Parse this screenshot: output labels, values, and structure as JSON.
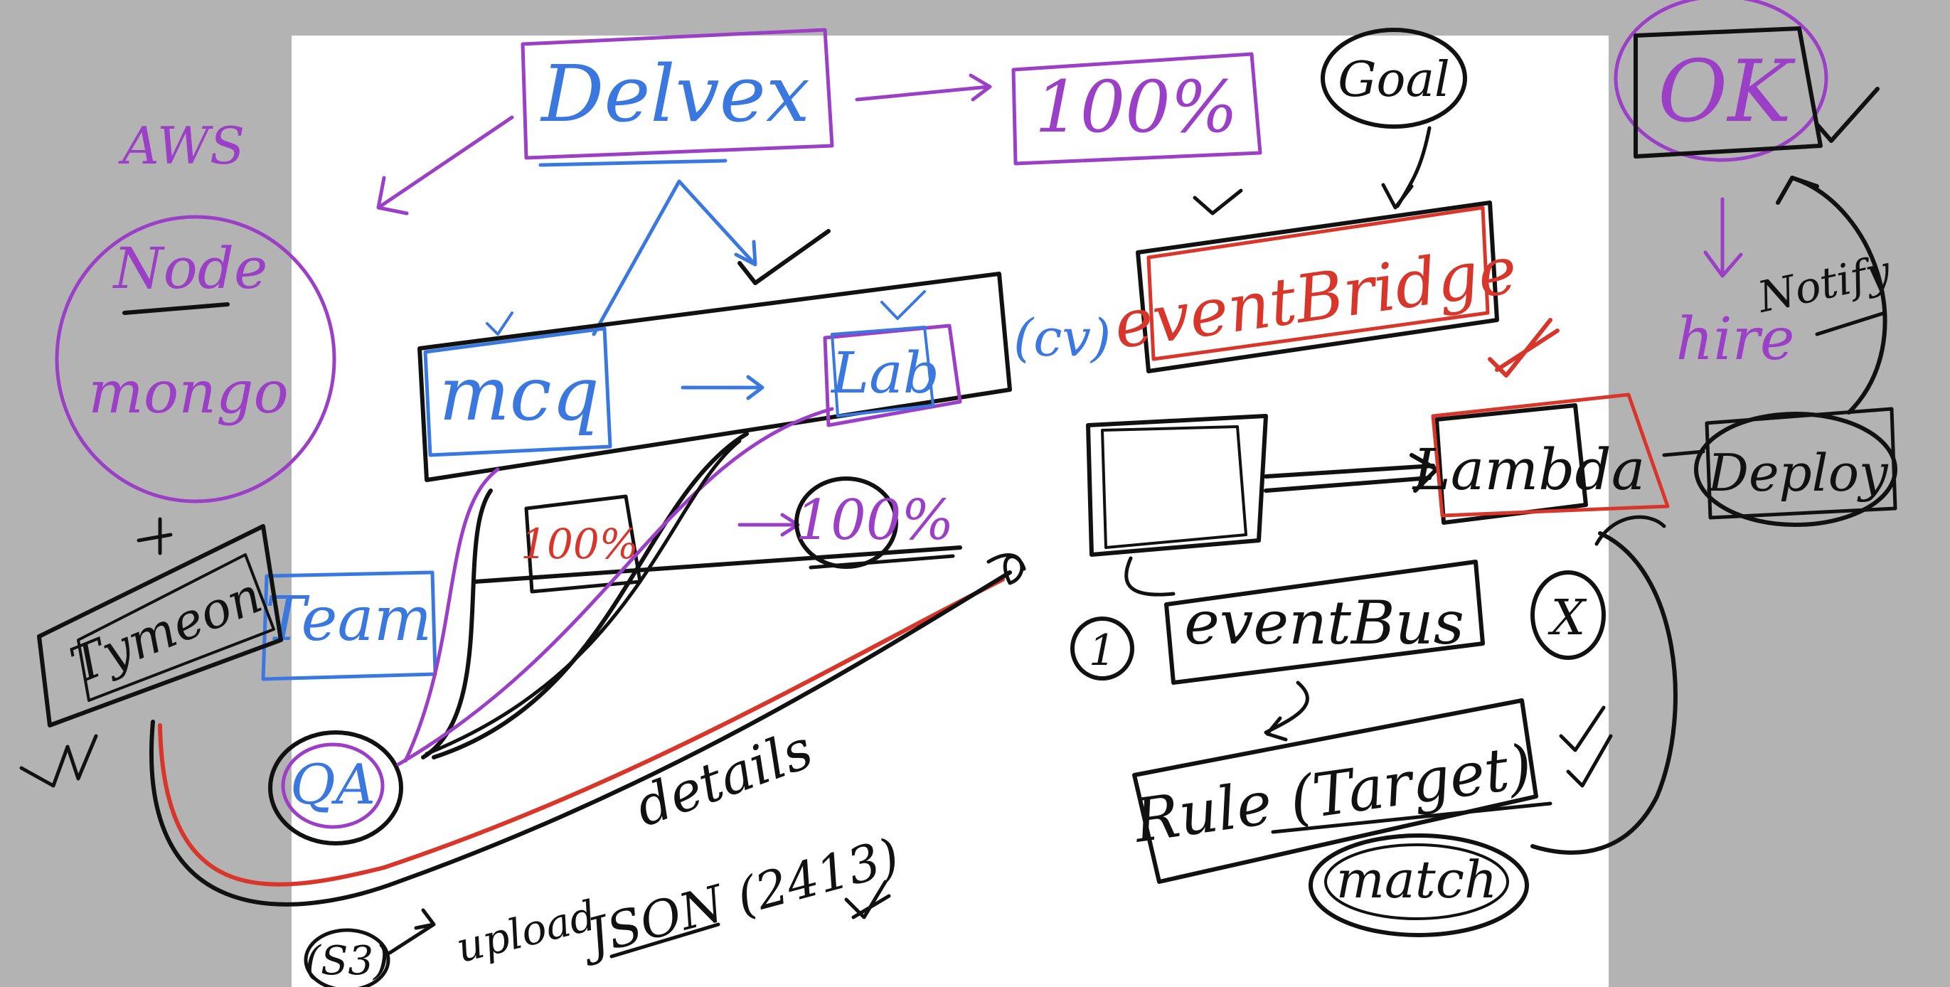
{
  "colors": {
    "background_outside": "#b3b3b3",
    "canvas": "#ffffff",
    "ink_black": "#111111",
    "ink_purple": "#9b3fc7",
    "ink_blue": "#3a78e0",
    "ink_red": "#d9362b"
  },
  "labels": {
    "delvex": "Delvex",
    "pct_top": "100%",
    "goal": "Goal",
    "ok": "OK",
    "aws": "AWS",
    "node": "Node",
    "mongo": "mongo",
    "mcq": "mcq",
    "lab": "Lab",
    "cv": "(cv)",
    "event_bridge": "eventBridge",
    "lambda": "Lambda",
    "deploy": "Deploy",
    "hire": "hire",
    "notify": "Notify",
    "event_bus": "eventBus",
    "rule_target": "Rule (Target)",
    "match": "match",
    "team": "Team",
    "tymeon": "Tymeon",
    "qa": "QA",
    "pct_small": "100%",
    "pct_mid": "100%",
    "details": "details",
    "s3": "(S3)",
    "upload": "upload",
    "json": "JSON (2413)",
    "circle_one": "1",
    "circle_x": "X"
  }
}
